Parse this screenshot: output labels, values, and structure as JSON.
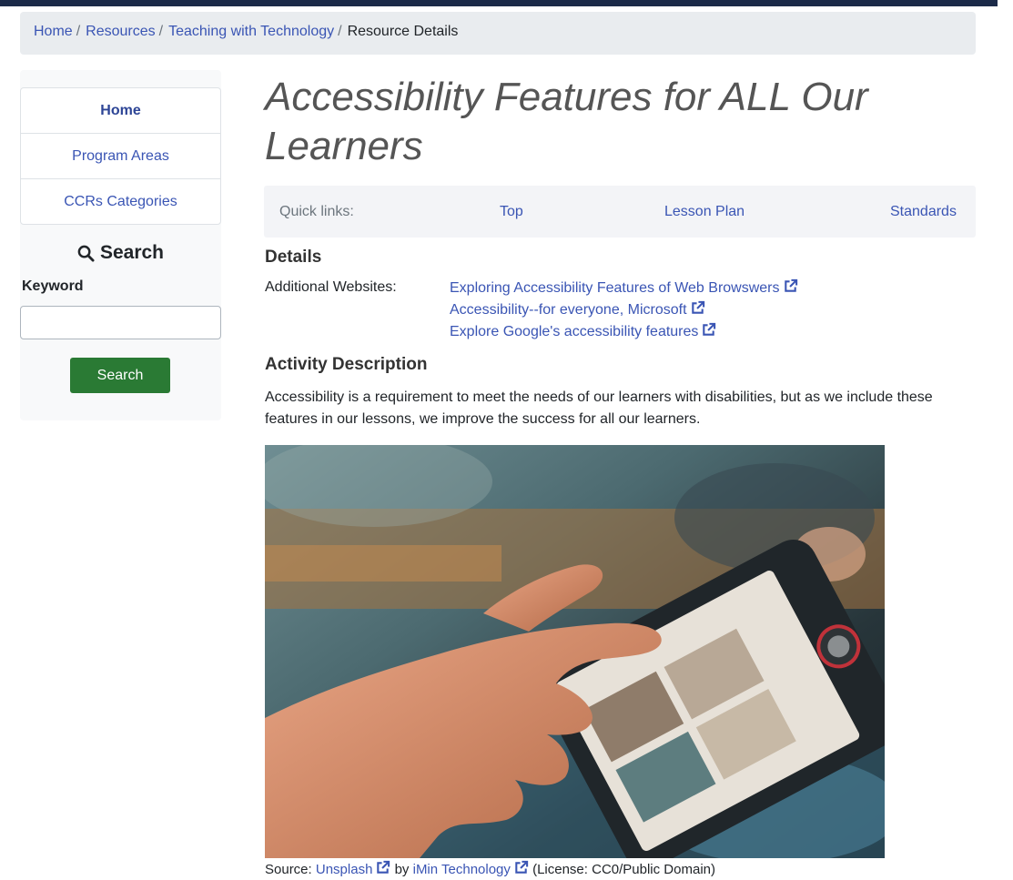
{
  "breadcrumb": {
    "home": "Home",
    "resources": "Resources",
    "teaching": "Teaching with Technology",
    "current": "Resource Details",
    "separator": "/"
  },
  "sidebar": {
    "nav": [
      "Home",
      "Program Areas",
      "CCRs Categories"
    ],
    "search_heading": "Search",
    "keyword_label": "Keyword",
    "keyword_value": "",
    "search_button": "Search"
  },
  "title": "Accessibility Features for ALL Our Learners",
  "quicklinks": {
    "label": "Quick links:",
    "links": [
      "Top",
      "Lesson Plan",
      "Standards"
    ]
  },
  "details": {
    "heading": "Details",
    "additional_label": "Additional Websites:",
    "websites": [
      "Exploring Accessibility Features of Web Browswers",
      "Accessibility--for everyone, Microsoft",
      "Explore Google's accessibility features"
    ]
  },
  "activity": {
    "heading": "Activity Description",
    "text": "Accessibility is a requirement to meet the needs of our learners with disabilities, but as we include these features in our lessons, we improve the success for all our learners."
  },
  "source": {
    "prefix": "Source:",
    "site": "Unsplash",
    "by": "by",
    "author": "iMin Technology",
    "license": "(License: CC0/Public Domain)"
  },
  "colors": {
    "link": "#3a55b4",
    "topbar": "#1b2a48",
    "search_button": "#2a7a34",
    "title": "#555555"
  },
  "icons": [
    "search-icon",
    "external-link-icon"
  ]
}
